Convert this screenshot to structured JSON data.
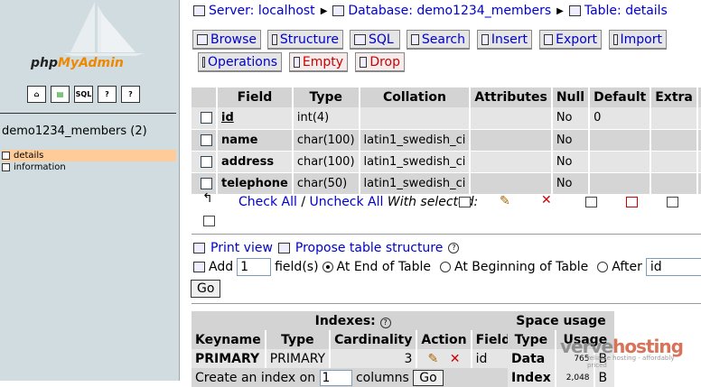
{
  "sidebar": {
    "logo_text_a": "php",
    "logo_text_b": "MyAdmin",
    "icons": [
      "home-icon",
      "sql-window-icon",
      "sql-query-icon",
      "docs-icon",
      "help-icon"
    ],
    "database": "demo1234_members (2)",
    "tables": [
      "details",
      "information"
    ]
  },
  "breadcrumb": {
    "server_label": "Server: localhost",
    "database_label": "Database: demo1234_members",
    "table_label": "Table: details"
  },
  "tabs": {
    "browse": "Browse",
    "structure": "Structure",
    "sql": "SQL",
    "search": "Search",
    "insert": "Insert",
    "export": "Export",
    "import": "Import",
    "operations": "Operations",
    "empty": "Empty",
    "drop": "Drop"
  },
  "structure": {
    "headers": [
      "Field",
      "Type",
      "Collation",
      "Attributes",
      "Null",
      "Default",
      "Extra"
    ],
    "rows": [
      {
        "field": "id",
        "type": "int(4)",
        "collation": "",
        "attributes": "",
        "null": "No",
        "default": "0",
        "extra": ""
      },
      {
        "field": "name",
        "type": "char(100)",
        "collation": "latin1_swedish_ci",
        "attributes": "",
        "null": "No",
        "default": "",
        "extra": ""
      },
      {
        "field": "address",
        "type": "char(100)",
        "collation": "latin1_swedish_ci",
        "attributes": "",
        "null": "No",
        "default": "",
        "extra": ""
      },
      {
        "field": "telephone",
        "type": "char(50)",
        "collation": "latin1_swedish_ci",
        "attributes": "",
        "null": "No",
        "default": "",
        "extra": ""
      }
    ]
  },
  "with_selected": {
    "check_all": "Check All",
    "slash": " / ",
    "uncheck_all": "Uncheck All",
    "label": "With selected:"
  },
  "actions": {
    "print_view": "Print view",
    "propose": "Propose table structure",
    "add_label": "Add",
    "add_value": "1",
    "fields_label": "field(s)",
    "end_label": "At End of Table",
    "beginning_label": "At Beginning of Table",
    "after_label": "After",
    "after_value": "id",
    "go": "Go"
  },
  "indexes": {
    "title": "Indexes:",
    "headers": [
      "Keyname",
      "Type",
      "Cardinality",
      "Action",
      "Field"
    ],
    "row": {
      "keyname": "PRIMARY",
      "type": "PRIMARY",
      "cardinality": "3",
      "field": "id"
    },
    "create_label": "Create an index on",
    "create_value": "1",
    "columns_label": "columns",
    "go": "Go"
  },
  "space": {
    "title": "Space usage",
    "headers": [
      "Type",
      "Usage"
    ],
    "rows": [
      {
        "type": "Data",
        "value": "765",
        "unit": "B"
      },
      {
        "type": "Index",
        "value": "2,048",
        "unit": "B"
      }
    ]
  },
  "watermark": {
    "brand_a": "verve",
    "brand_b": "hosting",
    "tagline": "reliable hosting - affordably priced"
  }
}
